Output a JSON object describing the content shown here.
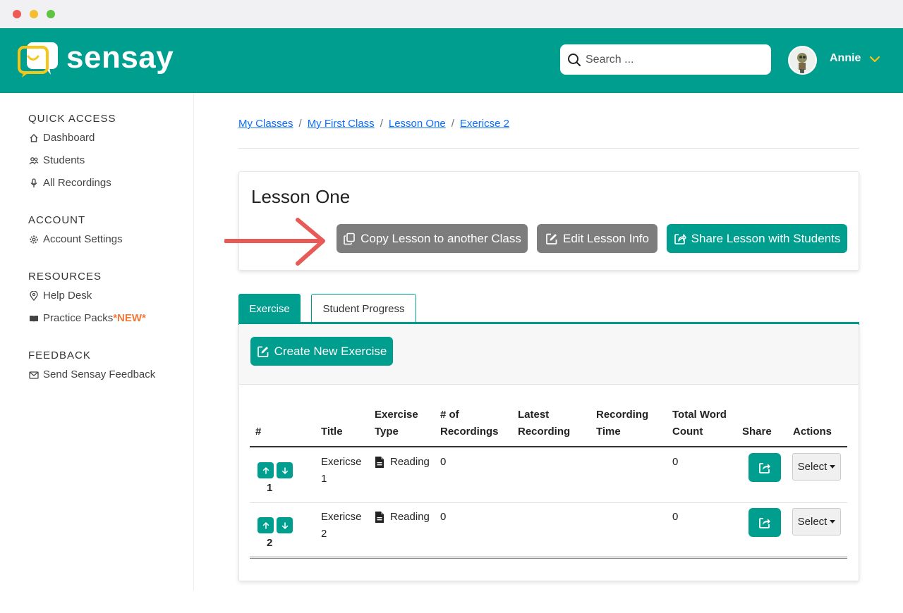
{
  "header": {
    "brand": "sensay",
    "search_placeholder": "Search ...",
    "username": "Annie",
    "colors": {
      "brand_teal": "#009e8f",
      "logo_yellow": "#f5c518"
    }
  },
  "sidebar": {
    "sections": [
      {
        "title": "QUICK ACCESS",
        "items": [
          {
            "label": "Dashboard",
            "icon": "home-icon"
          },
          {
            "label": "Students",
            "icon": "users-icon"
          },
          {
            "label": "All Recordings",
            "icon": "microphone-icon"
          }
        ]
      },
      {
        "title": "ACCOUNT",
        "items": [
          {
            "label": "Account Settings",
            "icon": "gear-icon"
          }
        ]
      },
      {
        "title": "RESOURCES",
        "items": [
          {
            "label": "Help Desk",
            "icon": "location-pin-icon"
          },
          {
            "label": "Practice Packs",
            "badge": "*NEW*",
            "icon": "book-icon"
          }
        ]
      },
      {
        "title": "FEEDBACK",
        "items": [
          {
            "label": "Send Sensay Feedback",
            "icon": "envelope-icon"
          }
        ]
      }
    ]
  },
  "breadcrumb": [
    "My Classes",
    "My First Class",
    "Lesson One",
    "Exericse 2"
  ],
  "lesson": {
    "title": "Lesson One",
    "buttons": {
      "copy": "Copy Lesson to another Class",
      "edit": "Edit Lesson Info",
      "share": "Share Lesson with Students"
    }
  },
  "tabs": [
    {
      "label": "Exercise",
      "active": true
    },
    {
      "label": "Student Progress",
      "active": false
    }
  ],
  "exercises": {
    "create_label": "Create New Exercise",
    "columns": [
      "#",
      "Title",
      "Exercise Type",
      "# of Recordings",
      "Latest Recording",
      "Recording Time",
      "Total Word Count",
      "Share",
      "Actions"
    ],
    "rows": [
      {
        "num": "1",
        "title_line1": "Exericse",
        "title_line2": "1",
        "type": "Reading",
        "recordings": "0",
        "latest": "",
        "time": "",
        "words": "0",
        "action": "Select"
      },
      {
        "num": "2",
        "title_line1": "Exericse",
        "title_line2": "2",
        "type": "Reading",
        "recordings": "0",
        "latest": "",
        "time": "",
        "words": "0",
        "action": "Select"
      }
    ]
  }
}
